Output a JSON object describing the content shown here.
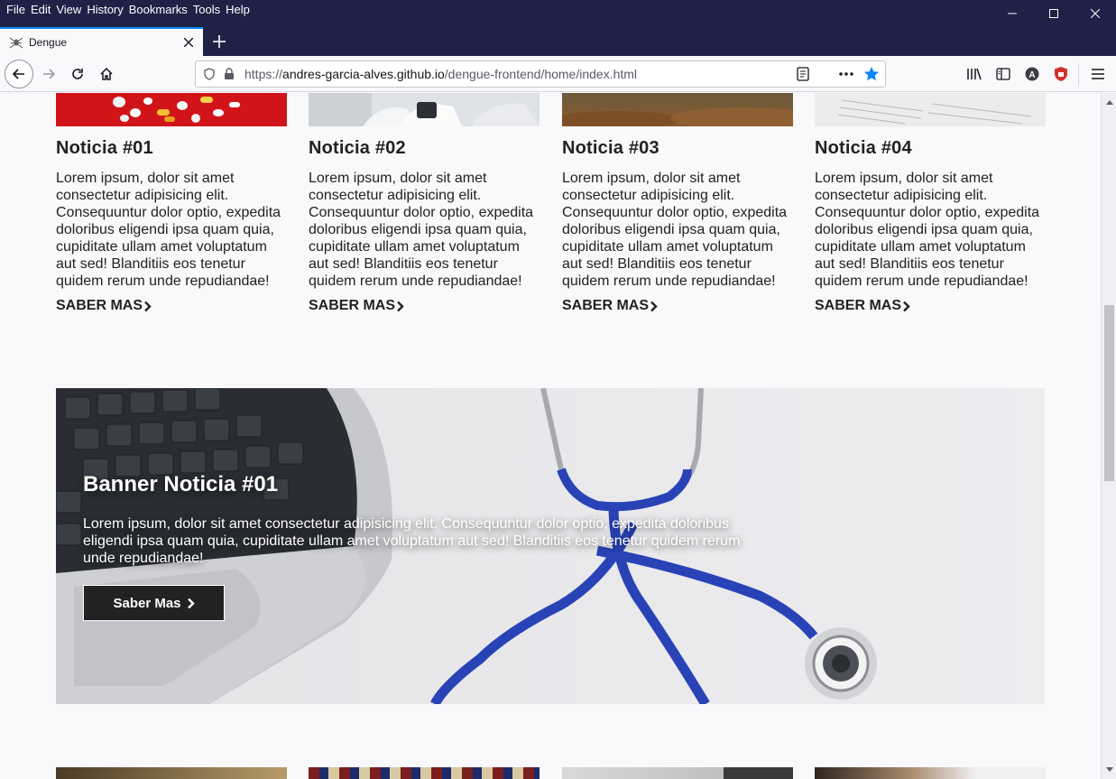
{
  "browser": {
    "menu": [
      "File",
      "Edit",
      "View",
      "History",
      "Bookmarks",
      "Tools",
      "Help"
    ],
    "tab": {
      "title": "Dengue"
    },
    "url": {
      "prefix": "https://",
      "host": "andres-garcia-alves.github.io",
      "path": "/dengue-frontend/home/index.html"
    }
  },
  "news": [
    {
      "title": "Noticia #01",
      "text": "Lorem ipsum, dolor sit amet consectetur adipisicing elit. Consequuntur dolor optio, expedita doloribus eligendi ipsa quam quia, cupiditate ullam amet voluptatum aut sed! Blanditiis eos tenetur quidem rerum unde repudiandae!",
      "link": "SABER MAS"
    },
    {
      "title": "Noticia #02",
      "text": "Lorem ipsum, dolor sit amet consectetur adipisicing elit. Consequuntur dolor optio, expedita doloribus eligendi ipsa quam quia, cupiditate ullam amet voluptatum aut sed! Blanditiis eos tenetur quidem rerum unde repudiandae!",
      "link": "SABER MAS"
    },
    {
      "title": "Noticia #03",
      "text": "Lorem ipsum, dolor sit amet consectetur adipisicing elit. Consequuntur dolor optio, expedita doloribus eligendi ipsa quam quia, cupiditate ullam amet voluptatum aut sed! Blanditiis eos tenetur quidem rerum unde repudiandae!",
      "link": "SABER MAS"
    },
    {
      "title": "Noticia #04",
      "text": "Lorem ipsum, dolor sit amet consectetur adipisicing elit. Consequuntur dolor optio, expedita doloribus eligendi ipsa quam quia, cupiditate ullam amet voluptatum aut sed! Blanditiis eos tenetur quidem rerum unde repudiandae!",
      "link": "SABER MAS"
    }
  ],
  "banner": {
    "title": "Banner Noticia #01",
    "text": "Lorem ipsum, dolor sit amet consectetur adipisicing elit. Consequuntur dolor optio, expedita doloribus eligendi ipsa quam quia, cupiditate ullam amet voluptatum aut sed! Blanditiis eos tenetur quidem rerum unde repudiandae!",
    "button": "Saber Mas"
  }
}
